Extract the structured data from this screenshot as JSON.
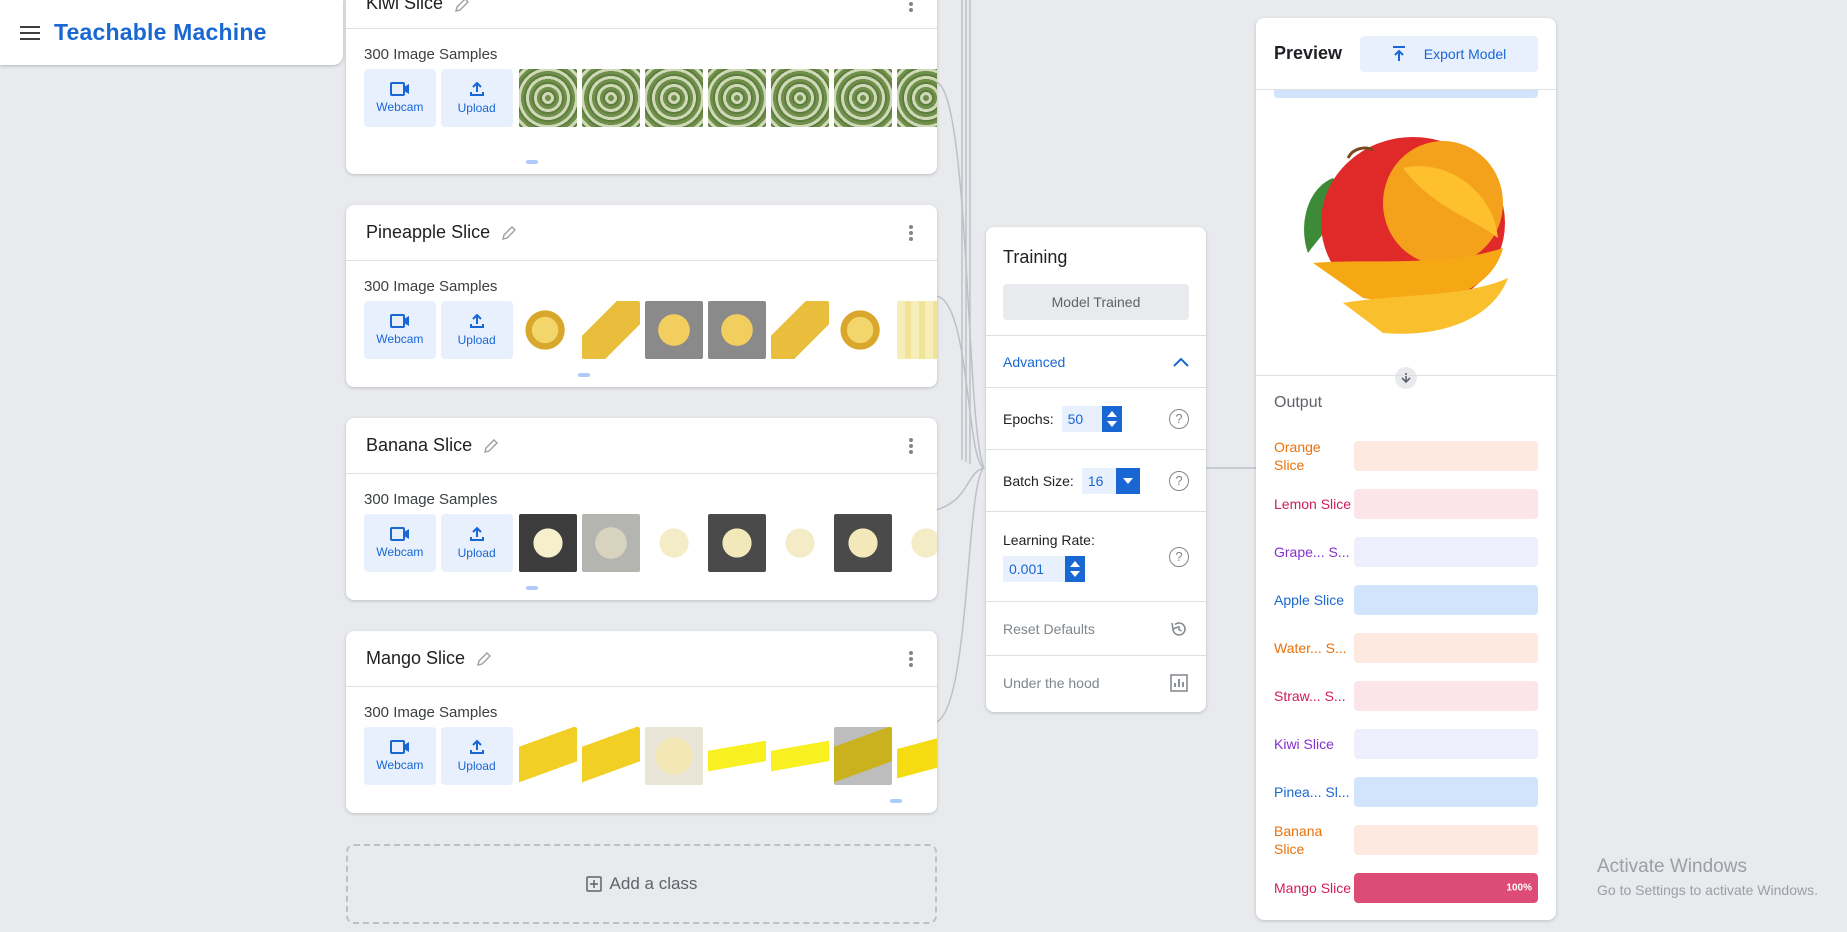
{
  "app": {
    "title": "Teachable Machine"
  },
  "classes": [
    {
      "name": "Kiwi Slice",
      "samples": "300 Image Samples",
      "thumb_style": [
        "t-kiwi",
        "t-kiwi",
        "t-kiwi",
        "t-kiwi",
        "t-kiwi",
        "t-kiwi",
        "t-kiwi"
      ],
      "scroll_pos": 0.02
    },
    {
      "name": "Pineapple Slice",
      "samples": "300 Image Samples",
      "thumb_style": [
        "t-pine",
        "t-pine2",
        "t-pine3",
        "t-pine3",
        "t-pine2",
        "t-pine",
        "t-pine4"
      ],
      "scroll_pos": 0.15
    },
    {
      "name": "Banana Slice",
      "samples": "300 Image Samples",
      "thumb_style": [
        "t-ban",
        "t-ban2",
        "t-ban3",
        "t-ban4",
        "t-ban3",
        "t-ban4",
        "t-ban3"
      ],
      "scroll_pos": 0.02
    },
    {
      "name": "Mango Slice",
      "samples": "300 Image Samples",
      "thumb_style": [
        "t-man",
        "t-man",
        "t-man2",
        "t-man3",
        "t-man3",
        "t-man4",
        "t-man5"
      ],
      "scroll_pos": 0.93
    }
  ],
  "sample_buttons": {
    "webcam": "Webcam",
    "upload": "Upload"
  },
  "add_class_label": "Add a class",
  "training": {
    "title": "Training",
    "train_button": "Model Trained",
    "advanced_label": "Advanced",
    "epochs_label": "Epochs:",
    "epochs_value": "50",
    "batch_label": "Batch Size:",
    "batch_value": "16",
    "lr_label": "Learning Rate:",
    "lr_value": "0.001",
    "reset_label": "Reset Defaults",
    "hood_label": "Under the hood",
    "help_glyph": "?"
  },
  "preview": {
    "title": "Preview",
    "export_label": "Export Model",
    "output_title": "Output",
    "outputs": [
      {
        "label": "Orange Slice",
        "color": "#e8710a",
        "bg": "#fde9df",
        "value": 0,
        "pct_text": ""
      },
      {
        "label": "Lemon Slice",
        "color": "#d01c5b",
        "bg": "#fce4e9",
        "value": 0,
        "pct_text": ""
      },
      {
        "label": "Grape... S...",
        "color": "#8430ce",
        "bg": "#eeeefc",
        "value": 0,
        "pct_text": ""
      },
      {
        "label": "Apple Slice",
        "color": "#1967d2",
        "bg": "#d2e3fc",
        "value": 0,
        "pct_text": ""
      },
      {
        "label": "Water... S...",
        "color": "#e8710a",
        "bg": "#fde9df",
        "value": 0,
        "pct_text": ""
      },
      {
        "label": "Straw... S...",
        "color": "#d01c5b",
        "bg": "#fce4e9",
        "value": 0,
        "pct_text": ""
      },
      {
        "label": "Kiwi Slice",
        "color": "#8430ce",
        "bg": "#eeeefc",
        "value": 0,
        "pct_text": ""
      },
      {
        "label": "Pinea... Sl...",
        "color": "#1967d2",
        "bg": "#d2e3fc",
        "value": 0,
        "pct_text": ""
      },
      {
        "label": "Banana Slice",
        "color": "#e8710a",
        "bg": "#fde9df",
        "value": 0,
        "pct_text": ""
      },
      {
        "label": "Mango Slice",
        "color": "#d01c5b",
        "bg": "#fce4e9",
        "fill": "#dc4c75",
        "value": 1.0,
        "pct_text": "100%"
      }
    ]
  },
  "watermark": {
    "line1": "Activate Windows",
    "line2": "Go to Settings to activate Windows."
  }
}
